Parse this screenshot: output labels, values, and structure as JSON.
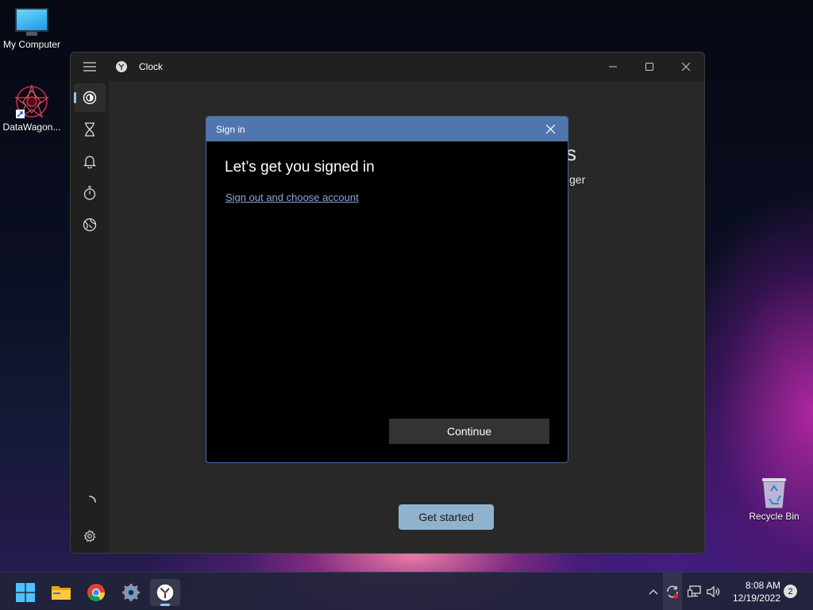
{
  "desktop": {
    "icons": [
      {
        "label": "My Computer"
      },
      {
        "label": "DataWagon..."
      },
      {
        "label": "Recycle Bin"
      }
    ]
  },
  "window": {
    "title": "Clock",
    "controls": [
      "minimize",
      "maximize",
      "close"
    ],
    "nav": {
      "items": [
        "focus-sessions",
        "timer",
        "alarm",
        "stopwatch",
        "world-clock"
      ],
      "active": "focus-sessions",
      "footer": [
        "loading-spinner",
        "settings"
      ]
    },
    "background_text_fragment_1": "s",
    "background_text_fragment_2": "ger",
    "get_started_label": "Get started"
  },
  "dialog": {
    "title": "Sign in",
    "heading": "Let’s get you signed in",
    "link": "Sign out and choose account",
    "continue_label": "Continue"
  },
  "taskbar": {
    "apps": [
      "start",
      "file-explorer",
      "chrome",
      "settings",
      "clock"
    ],
    "active_app": "clock",
    "time": "8:08 AM",
    "date": "12/19/2022",
    "notification_count": "2"
  },
  "colors": {
    "dialog_title_bar": "#4f77ad",
    "accent": "#9cc3ef",
    "get_started_button": "#8fb3cf"
  }
}
